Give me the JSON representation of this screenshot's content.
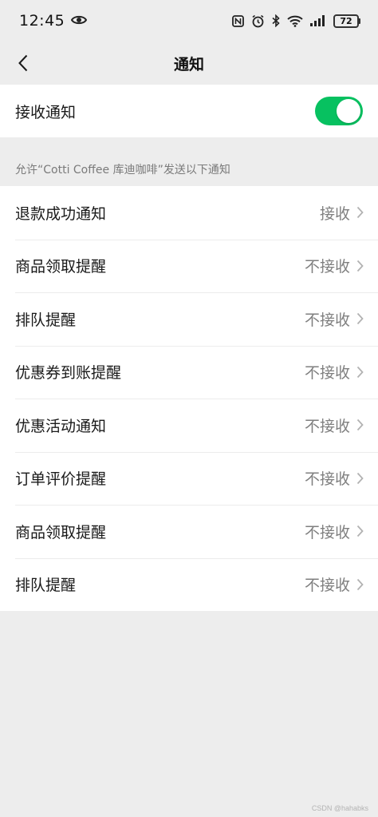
{
  "status_bar": {
    "time": "12:45",
    "battery": "72"
  },
  "nav": {
    "title": "通知"
  },
  "toggle": {
    "label": "接收通知",
    "state": "on",
    "color": "#07c160"
  },
  "caption": "允许“Cotti Coffee 库迪咖啡”发送以下通知",
  "items": [
    {
      "label": "退款成功通知",
      "value": "接收"
    },
    {
      "label": "商品领取提醒",
      "value": "不接收"
    },
    {
      "label": "排队提醒",
      "value": "不接收"
    },
    {
      "label": "优惠券到账提醒",
      "value": "不接收"
    },
    {
      "label": "优惠活动通知",
      "value": "不接收"
    },
    {
      "label": "订单评价提醒",
      "value": "不接收"
    },
    {
      "label": "商品领取提醒",
      "value": "不接收"
    },
    {
      "label": "排队提醒",
      "value": "不接收"
    }
  ],
  "watermark": "CSDN @hahabks"
}
